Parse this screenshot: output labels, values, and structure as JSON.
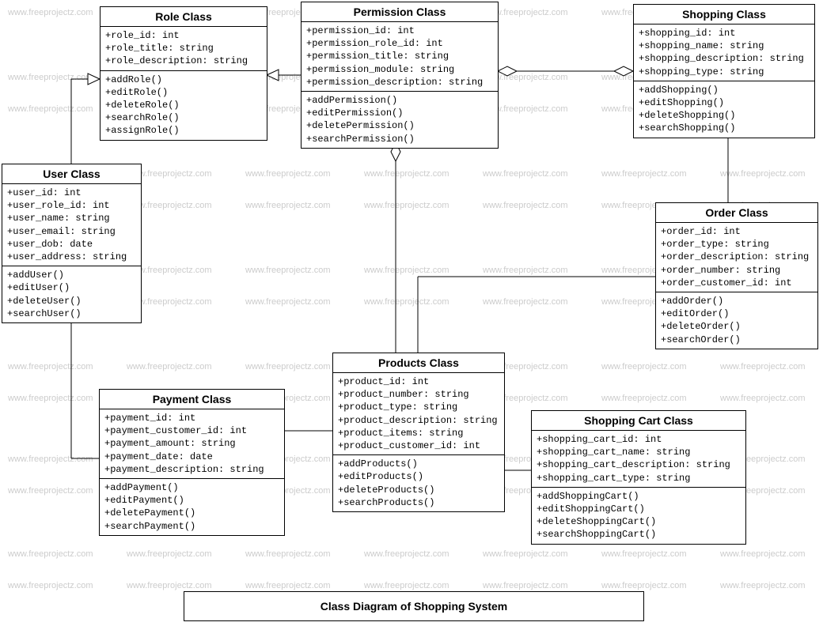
{
  "watermark_text": "www.freeprojectz.com",
  "caption": "Class Diagram of Shopping System",
  "classes": {
    "role": {
      "title": "Role Class",
      "attrs": [
        "+role_id: int",
        "+role_title: string",
        "+role_description: string"
      ],
      "ops": [
        "+addRole()",
        "+editRole()",
        "+deleteRole()",
        "+searchRole()",
        "+assignRole()"
      ]
    },
    "permission": {
      "title": "Permission Class",
      "attrs": [
        "+permission_id: int",
        "+permission_role_id: int",
        "+permission_title: string",
        "+permission_module: string",
        "+permission_description: string"
      ],
      "ops": [
        "+addPermission()",
        "+editPermission()",
        "+deletePermission()",
        "+searchPermission()"
      ]
    },
    "shopping": {
      "title": "Shopping Class",
      "attrs": [
        "+shopping_id: int",
        "+shopping_name: string",
        "+shopping_description: string",
        "+shopping_type: string"
      ],
      "ops": [
        "+addShopping()",
        "+editShopping()",
        "+deleteShopping()",
        "+searchShopping()"
      ]
    },
    "user": {
      "title": "User Class",
      "attrs": [
        "+user_id: int",
        "+user_role_id: int",
        "+user_name: string",
        "+user_email: string",
        "+user_dob: date",
        "+user_address: string"
      ],
      "ops": [
        "+addUser()",
        "+editUser()",
        "+deleteUser()",
        "+searchUser()"
      ]
    },
    "order": {
      "title": "Order Class",
      "attrs": [
        "+order_id: int",
        "+order_type: string",
        "+order_description: string",
        "+order_number: string",
        "+order_customer_id: int"
      ],
      "ops": [
        "+addOrder()",
        "+editOrder()",
        "+deleteOrder()",
        "+searchOrder()"
      ]
    },
    "payment": {
      "title": "Payment Class",
      "attrs": [
        "+payment_id: int",
        "+payment_customer_id: int",
        "+payment_amount: string",
        "+payment_date: date",
        "+payment_description: string"
      ],
      "ops": [
        "+addPayment()",
        "+editPayment()",
        "+deletePayment()",
        "+searchPayment()"
      ]
    },
    "products": {
      "title": "Products  Class",
      "attrs": [
        "+product_id: int",
        "+product_number: string",
        "+product_type: string",
        "+product_description: string",
        "+product_items: string",
        "+product_customer_id: int"
      ],
      "ops": [
        "+addProducts()",
        "+editProducts()",
        "+deleteProducts()",
        "+searchProducts()"
      ]
    },
    "shoppingcart": {
      "title": "Shopping Cart Class",
      "attrs": [
        "+shopping_cart_id: int",
        "+shopping_cart_name: string",
        "+shopping_cart_description: string",
        "+shopping_cart_type: string"
      ],
      "ops": [
        "+addShoppingCart()",
        "+editShoppingCart()",
        "+deleteShoppingCart()",
        "+searchShoppingCart()"
      ]
    }
  }
}
